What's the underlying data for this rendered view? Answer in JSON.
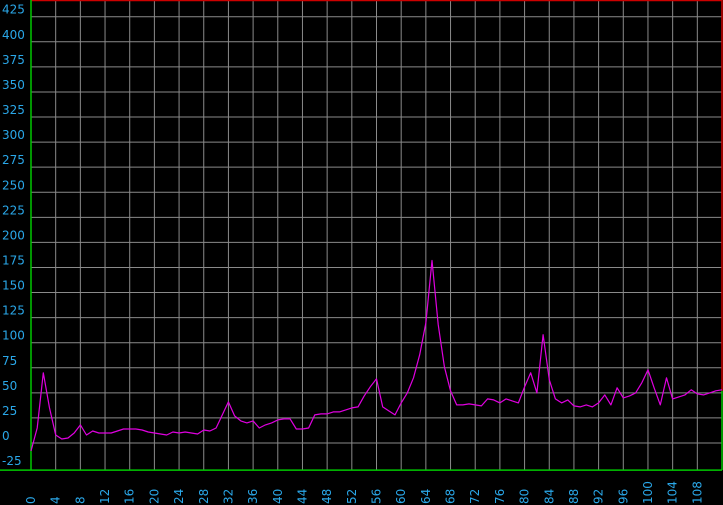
{
  "chart_data": {
    "type": "line",
    "title": "",
    "xlabel": "",
    "ylabel": "",
    "xlim": [
      0,
      112
    ],
    "ylim": [
      -25,
      440
    ],
    "grid": true,
    "yticks": [
      -25,
      0,
      25,
      50,
      75,
      100,
      125,
      150,
      175,
      200,
      225,
      250,
      275,
      300,
      325,
      350,
      375,
      400,
      425
    ],
    "xticks": [
      0,
      4,
      8,
      12,
      16,
      20,
      24,
      28,
      32,
      36,
      40,
      44,
      48,
      52,
      56,
      60,
      64,
      68,
      72,
      76,
      80,
      84,
      88,
      92,
      96,
      100,
      104,
      108
    ],
    "colors": {
      "background": "#000000",
      "grid": "#8a8a8a",
      "line": "#e000e0",
      "tick_labels": "#2aa7e8",
      "frame_top_right": "#cc0000",
      "baseline": "#00c800"
    },
    "series": [
      {
        "values": [
          [
            0,
            -8
          ],
          [
            1,
            15
          ],
          [
            2,
            70
          ],
          [
            3,
            35
          ],
          [
            4,
            8
          ],
          [
            5,
            4
          ],
          [
            6,
            5
          ],
          [
            7,
            10
          ],
          [
            8,
            18
          ],
          [
            9,
            8
          ],
          [
            10,
            12
          ],
          [
            11,
            10
          ],
          [
            12,
            10
          ],
          [
            13,
            10
          ],
          [
            14,
            12
          ],
          [
            15,
            14
          ],
          [
            16,
            14
          ],
          [
            17,
            14
          ],
          [
            18,
            13
          ],
          [
            19,
            11
          ],
          [
            20,
            10
          ],
          [
            21,
            9
          ],
          [
            22,
            8
          ],
          [
            23,
            11
          ],
          [
            24,
            10
          ],
          [
            25,
            11
          ],
          [
            26,
            10
          ],
          [
            27,
            9
          ],
          [
            28,
            13
          ],
          [
            29,
            12
          ],
          [
            30,
            15
          ],
          [
            31,
            28
          ],
          [
            32,
            41
          ],
          [
            33,
            27
          ],
          [
            34,
            22
          ],
          [
            35,
            20
          ],
          [
            36,
            22
          ],
          [
            37,
            15
          ],
          [
            38,
            18
          ],
          [
            39,
            20
          ],
          [
            40,
            23
          ],
          [
            41,
            24
          ],
          [
            42,
            24
          ],
          [
            43,
            14
          ],
          [
            44,
            14
          ],
          [
            45,
            15
          ],
          [
            46,
            28
          ],
          [
            47,
            29
          ],
          [
            48,
            29
          ],
          [
            49,
            31
          ],
          [
            50,
            31
          ],
          [
            51,
            33
          ],
          [
            52,
            35
          ],
          [
            53,
            36
          ],
          [
            54,
            47
          ],
          [
            55,
            56
          ],
          [
            56,
            64
          ],
          [
            57,
            36
          ],
          [
            58,
            32
          ],
          [
            59,
            28
          ],
          [
            60,
            40
          ],
          [
            61,
            50
          ],
          [
            62,
            65
          ],
          [
            63,
            88
          ],
          [
            64,
            120
          ],
          [
            65,
            182
          ],
          [
            66,
            118
          ],
          [
            67,
            76
          ],
          [
            68,
            52
          ],
          [
            69,
            38
          ],
          [
            70,
            38
          ],
          [
            71,
            39
          ],
          [
            72,
            38
          ],
          [
            73,
            37
          ],
          [
            74,
            44
          ],
          [
            75,
            43
          ],
          [
            76,
            40
          ],
          [
            77,
            44
          ],
          [
            78,
            42
          ],
          [
            79,
            40
          ],
          [
            80,
            56
          ],
          [
            81,
            70
          ],
          [
            82,
            50
          ],
          [
            83,
            108
          ],
          [
            84,
            63
          ],
          [
            85,
            44
          ],
          [
            86,
            40
          ],
          [
            87,
            43
          ],
          [
            88,
            37
          ],
          [
            89,
            36
          ],
          [
            90,
            38
          ],
          [
            91,
            36
          ],
          [
            92,
            40
          ],
          [
            93,
            48
          ],
          [
            94,
            38
          ],
          [
            95,
            55
          ],
          [
            96,
            45
          ],
          [
            97,
            47
          ],
          [
            98,
            50
          ],
          [
            99,
            60
          ],
          [
            100,
            73
          ],
          [
            101,
            55
          ],
          [
            102,
            38
          ],
          [
            103,
            65
          ],
          [
            104,
            44
          ],
          [
            105,
            46
          ],
          [
            106,
            48
          ],
          [
            107,
            53
          ],
          [
            108,
            49
          ],
          [
            109,
            48
          ],
          [
            110,
            50
          ],
          [
            111,
            52
          ],
          [
            112,
            53
          ]
        ]
      }
    ]
  }
}
